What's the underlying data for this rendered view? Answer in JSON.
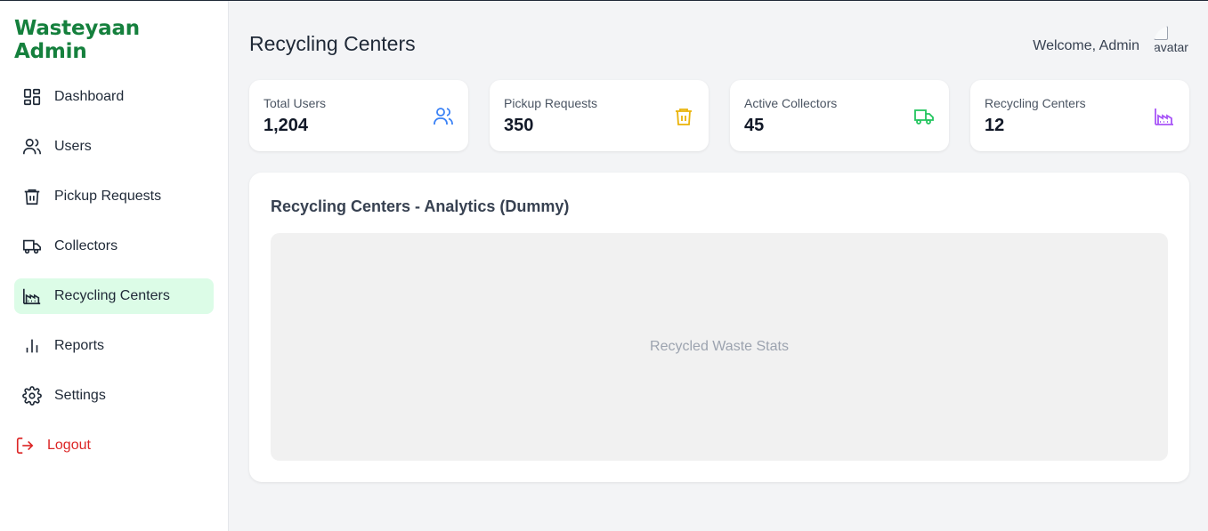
{
  "sidebar": {
    "brand": "Wasteyaan Admin",
    "items": [
      {
        "label": "Dashboard",
        "icon": "dashboard-icon"
      },
      {
        "label": "Users",
        "icon": "users-icon"
      },
      {
        "label": "Pickup Requests",
        "icon": "trash-icon"
      },
      {
        "label": "Collectors",
        "icon": "truck-icon"
      },
      {
        "label": "Recycling Centers",
        "icon": "factory-icon",
        "active": true
      },
      {
        "label": "Reports",
        "icon": "bar-chart-icon"
      },
      {
        "label": "Settings",
        "icon": "gear-icon"
      }
    ],
    "logout": {
      "label": "Logout",
      "icon": "logout-icon"
    }
  },
  "header": {
    "title": "Recycling Centers",
    "welcome": "Welcome, Admin",
    "avatar_alt": "avatar"
  },
  "stats": [
    {
      "label": "Total Users",
      "value": "1,204",
      "icon": "users-icon",
      "color": "#3b82f6"
    },
    {
      "label": "Pickup Requests",
      "value": "350",
      "icon": "trash-icon",
      "color": "#eab308"
    },
    {
      "label": "Active Collectors",
      "value": "45",
      "icon": "truck-icon",
      "color": "#22c55e"
    },
    {
      "label": "Recycling Centers",
      "value": "12",
      "icon": "factory-icon",
      "color": "#a855f7"
    }
  ],
  "panel": {
    "title": "Recycling Centers - Analytics (Dummy)",
    "placeholder": "Recycled Waste Stats"
  },
  "colors": {
    "brand": "#15803d",
    "active_bg": "#dcfce7",
    "logout": "#dc2626"
  }
}
